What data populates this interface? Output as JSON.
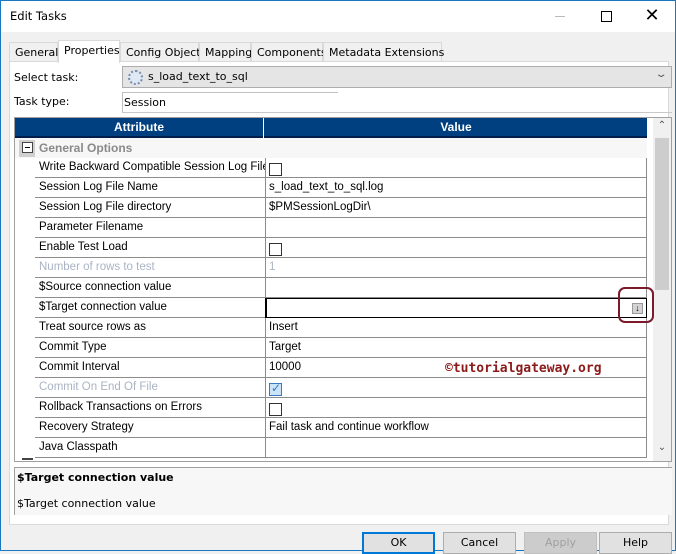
{
  "window": {
    "title": "Edit Tasks",
    "controls": {
      "minimize": "—",
      "maximize": "☐",
      "close": "✕"
    }
  },
  "tabs": [
    {
      "label": "General",
      "active": false
    },
    {
      "label": "Properties",
      "active": true
    },
    {
      "label": "Config Object",
      "active": false
    },
    {
      "label": "Mapping",
      "active": false
    },
    {
      "label": "Components",
      "active": false
    },
    {
      "label": "Metadata Extensions",
      "active": false
    }
  ],
  "form": {
    "select_task_label": "Select task:",
    "select_task_value": "s_load_text_to_sql",
    "select_task_icon": "gear-icon",
    "task_type_label": "Task type:",
    "task_type_value": "Session"
  },
  "grid": {
    "headers": {
      "attribute": "Attribute",
      "value": "Value"
    },
    "group": {
      "label": "General Options",
      "expanded": true
    },
    "rows": [
      {
        "attribute": "Write Backward Compatible Session Log File",
        "type": "checkbox",
        "checked": false,
        "disabled": false,
        "value": ""
      },
      {
        "attribute": "Session Log File Name",
        "type": "text",
        "value": "s_load_text_to_sql.log",
        "disabled": false
      },
      {
        "attribute": "Session Log File directory",
        "type": "text",
        "value": "$PMSessionLogDir\\",
        "disabled": false
      },
      {
        "attribute": "Parameter Filename",
        "type": "text",
        "value": "",
        "disabled": false
      },
      {
        "attribute": "Enable Test Load",
        "type": "checkbox",
        "checked": false,
        "disabled": false,
        "value": ""
      },
      {
        "attribute": "Number of rows to test",
        "type": "text",
        "value": "1",
        "disabled": true
      },
      {
        "attribute": "$Source connection value",
        "type": "text",
        "value": "",
        "disabled": false
      },
      {
        "attribute": "$Target connection value",
        "type": "dropdown-edit",
        "value": "",
        "disabled": false,
        "editing": true
      },
      {
        "attribute": "Treat source rows as",
        "type": "text",
        "value": "Insert",
        "disabled": false
      },
      {
        "attribute": "Commit Type",
        "type": "text",
        "value": "Target",
        "disabled": false
      },
      {
        "attribute": "Commit Interval",
        "type": "text",
        "value": "10000",
        "disabled": false
      },
      {
        "attribute": "Commit On End Of File",
        "type": "checkbox",
        "checked": true,
        "disabled": true,
        "value": ""
      },
      {
        "attribute": "Rollback Transactions on Errors",
        "type": "checkbox",
        "checked": false,
        "disabled": false,
        "value": ""
      },
      {
        "attribute": "Recovery Strategy",
        "type": "text",
        "value": "Fail task and continue workflow",
        "disabled": false
      },
      {
        "attribute": "Java Classpath",
        "type": "text",
        "value": "",
        "disabled": false
      }
    ],
    "scrollbar": {
      "up": "⌃",
      "down": "⌄"
    }
  },
  "description": {
    "title": "$Target connection value",
    "body": "$Target connection value"
  },
  "buttons": {
    "ok": "OK",
    "cancel": "Cancel",
    "apply": "Apply",
    "help": "Help"
  },
  "watermark": "©tutorialgateway.org",
  "colors": {
    "header_bg": "#003f80",
    "accent": "#0078d7",
    "highlight_ring": "#7a1a2a"
  }
}
